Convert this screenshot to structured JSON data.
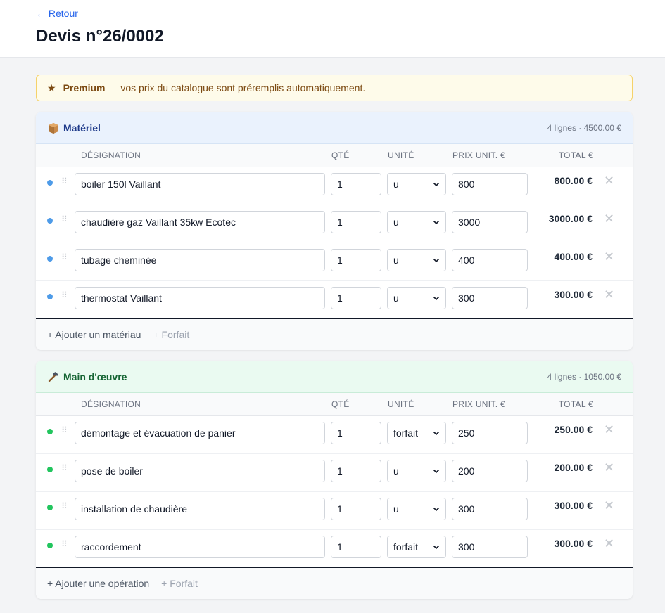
{
  "header": {
    "back_label": "← Retour",
    "title": "Devis n°26/0002"
  },
  "banner": {
    "star": "★",
    "strong": "Premium",
    "text": "— vos prix du catalogue sont préremplis automatiquement."
  },
  "columns": {
    "designation": "DÉSIGNATION",
    "qty": "QTÉ",
    "unit": "UNITÉ",
    "price": "PRIX UNIT. €",
    "total": "TOTAL €"
  },
  "sections": [
    {
      "title": "Matériel",
      "icon": "box-icon",
      "meta": "4 lignes · 4500.00 €",
      "color": "#4e9be8",
      "rows": [
        {
          "designation": "boiler 150l Vaillant",
          "qty": "1",
          "unit": "u",
          "price": "800",
          "total": "800.00 €"
        },
        {
          "designation": "chaudière gaz Vaillant 35kw Ecotec",
          "qty": "1",
          "unit": "u",
          "price": "3000",
          "total": "3000.00 €"
        },
        {
          "designation": "tubage cheminée",
          "qty": "1",
          "unit": "u",
          "price": "400",
          "total": "400.00 €"
        },
        {
          "designation": "thermostat Vaillant",
          "qty": "1",
          "unit": "u",
          "price": "300",
          "total": "300.00 €"
        }
      ],
      "add_label": "+ Ajouter un matériau",
      "forfait_label": "+ Forfait"
    },
    {
      "title": "Main d'œuvre",
      "icon": "hammer-icon",
      "meta": "4 lignes · 1050.00 €",
      "color": "#22c55e",
      "rows": [
        {
          "designation": "démontage et évacuation de panier",
          "qty": "1",
          "unit": "forfait",
          "price": "250",
          "total": "250.00 €"
        },
        {
          "designation": "pose de boiler",
          "qty": "1",
          "unit": "u",
          "price": "200",
          "total": "200.00 €"
        },
        {
          "designation": "installation de chaudière",
          "qty": "1",
          "unit": "u",
          "price": "300",
          "total": "300.00 €"
        },
        {
          "designation": "raccordement",
          "qty": "1",
          "unit": "forfait",
          "price": "300",
          "total": "300.00 €"
        }
      ],
      "add_label": "+ Ajouter une opération",
      "forfait_label": "+ Forfait"
    }
  ],
  "row_controls": {
    "grip": "⠿",
    "delete": "✕"
  }
}
